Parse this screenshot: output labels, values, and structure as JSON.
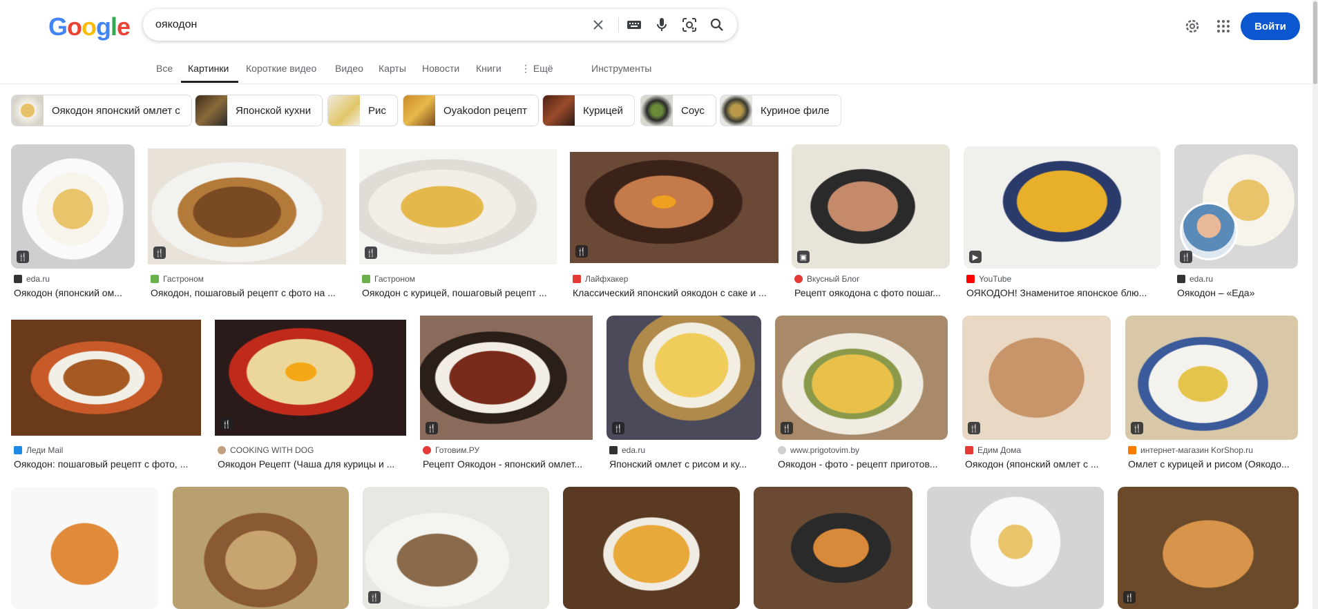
{
  "header": {
    "search_value": "оякодон",
    "signin_label": "Войти"
  },
  "tabs": [
    {
      "label": "Все"
    },
    {
      "label": "Картинки"
    },
    {
      "label": "Короткие видео"
    },
    {
      "label": "Видео"
    },
    {
      "label": "Карты"
    },
    {
      "label": "Новости"
    },
    {
      "label": "Книги"
    },
    {
      "label": "⋮ Ещё"
    },
    {
      "label": "Инструменты"
    }
  ],
  "chips": [
    {
      "label": "Оякодон японский омлет с"
    },
    {
      "label": "Японской кухни"
    },
    {
      "label": "Рис"
    },
    {
      "label": "Oyakodon рецепт"
    },
    {
      "label": "Курицей"
    },
    {
      "label": "Соус"
    },
    {
      "label": "Куриное филе"
    }
  ],
  "results": [
    {
      "source": "eda.ru",
      "title": "Оякодон (японский ом..."
    },
    {
      "source": "Гастроном",
      "title": "Оякодон, пошаговый рецепт с фото на ..."
    },
    {
      "source": "Гастроном",
      "title": "Оякодон с курицей, пошаговый рецепт ..."
    },
    {
      "source": "Лайфхакер",
      "title": "Классический японский оякодон с саке и ..."
    },
    {
      "source": "Вкусный Блог",
      "title": "Рецепт оякодона с фото пошаг..."
    },
    {
      "source": "YouTube",
      "title": "ОЯКОДОН! Знаменитое японское блю..."
    },
    {
      "source": "eda.ru",
      "title": "Оякодон – «Еда»"
    },
    {
      "source": "Леди Mail",
      "title": "Оякодон: пошаговый рецепт с фото, ..."
    },
    {
      "source": "COOKING WITH DOG",
      "title": "Оякодон Рецепт (Чаша для курицы и ..."
    },
    {
      "source": "Готовим.РУ",
      "title": "Рецепт Оякодон - японский омлет..."
    },
    {
      "source": "eda.ru",
      "title": "Японский омлет с рисом и ку..."
    },
    {
      "source": "www.prigotovim.by",
      "title": "Оякодон - фото - рецепт приготов..."
    },
    {
      "source": "Едим Дома",
      "title": "Оякодон (японский омлет с ..."
    },
    {
      "source": "интернет-магазин KorShop.ru",
      "title": "Омлет с курицей и рисом (Оякодо..."
    }
  ],
  "colors": {
    "signin_bg": "#0b57d0",
    "logo": [
      "#4285f4",
      "#ea4335",
      "#fbbc05",
      "#4285f4",
      "#34a853",
      "#ea4335"
    ]
  },
  "icons": [
    "clear-icon",
    "keyboard-icon",
    "mic-icon",
    "lens-icon",
    "search-icon",
    "settings-icon",
    "apps-icon",
    "recipe-icon",
    "play-icon",
    "gallery-icon"
  ]
}
